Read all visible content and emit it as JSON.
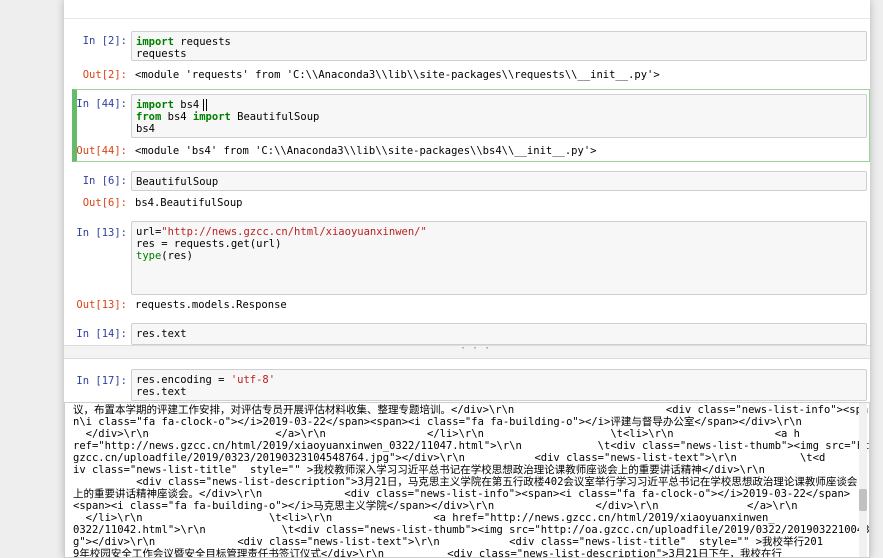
{
  "cells": [
    {
      "in_prompt": "In  [2]:",
      "code": [
        "import requests",
        "requests"
      ],
      "out_prompt": "Out[2]:",
      "output": "<module 'requests' from 'C:\\\\Anaconda3\\\\lib\\\\site-packages\\\\requests\\\\__init__.py'>"
    },
    {
      "in_prompt": "In  [44]:",
      "code": [
        "import bs4",
        "from bs4 import BeautifulSoup",
        "bs4"
      ],
      "out_prompt": "Out[44]:",
      "output": "<module 'bs4' from 'C:\\\\Anaconda3\\\\lib\\\\site-packages\\\\bs4\\\\__init__.py'>"
    },
    {
      "in_prompt": "In  [6]:",
      "code": [
        "BeautifulSoup"
      ],
      "out_prompt": "Out[6]:",
      "output": "bs4.BeautifulSoup"
    },
    {
      "in_prompt": "In  [13]:",
      "code": [
        "url=\"http://news.gzcc.cn/html/xiaoyuanxinwen/\"",
        "res = requests.get(url)",
        "type(res)"
      ],
      "out_prompt": "Out[13]:",
      "output": "requests.models.Response"
    },
    {
      "in_prompt": "In  [14]:",
      "code": [
        "res.text"
      ]
    },
    {
      "in_prompt": "In  [17]:",
      "code": [
        "res.encoding = 'utf-8'",
        "res.text"
      ]
    }
  ],
  "long_output_lines": [
    "议，布置本学期的评建工作安排，对评估专员开展评估材料收集、整理专题培训。</div>\\r\\n                        <div class=\"news-list-info\"><span",
    "n\\i class=\"fa fa-clock-o\"></i>2019-03-22</span><span><i class=\"fa fa-building-o\"></i>评建与督导办公室</span></div>\\r\\n",
    "  </div>\\r\\n                    </a>\\r\\n                </li>\\r\\n                    \\t<li>\\r\\n                <a h",
    "ref=\"http://news.gzcc.cn/html/2019/xiaoyuanxinwen_0322/11047.html\">\\r\\n            \\t<div class=\"news-list-thumb\"><img src=\"http://oa.",
    "gzcc.cn/uploadfile/2019/0323/20190323104548764.jpg\"></div>\\r\\n           <div class=\"news-list-text\">\\r\\n          \\t<d",
    "iv class=\"news-list-title\"  style=\"\" >我校教师深入学习习近平总书记在学校思想政治理论课教师座谈会上的重要讲话精神</div>\\r\\n",
    "          <div class=\"news-list-description\">3月21日，马克思主义学院在第五行政楼402会议室举行学习习近平总书记在学校思想政治理论课教师座谈会",
    "上的重要讲话精神座谈会。</div>\\r\\n             <div class=\"news-list-info\"><span><i class=\"fa fa-clock-o\"></i>2019-03-22</span>",
    "<span><i class=\"fa fa-building-o\"></i>马克思主义学院</span></div>\\r\\n                </div>\\r\\n              </a>\\r\\n",
    "  </li>\\r\\n                    \\t<li>\\r\\n                <a href=\"http://news.gzcc.cn/html/2019/xiaoyuanxinwen_",
    "0322/11042.html\">\\r\\n            \\t<div class=\"news-list-thumb\"><img src=\"http://oa.gzcc.cn/uploadfile/2019/0322/20190322100432800.jp",
    "g\"></div>\\r\\n             <div class=\"news-list-text\">\\r\\n           <div class=\"news-list-title\"  style=\"\" >我校举行201",
    "9年校园安全工作会议暨安全目标管理责任书签订仪式</div>\\r\\n          <div class=\"news-list-description\">3月21日下午，我校在行"
  ]
}
